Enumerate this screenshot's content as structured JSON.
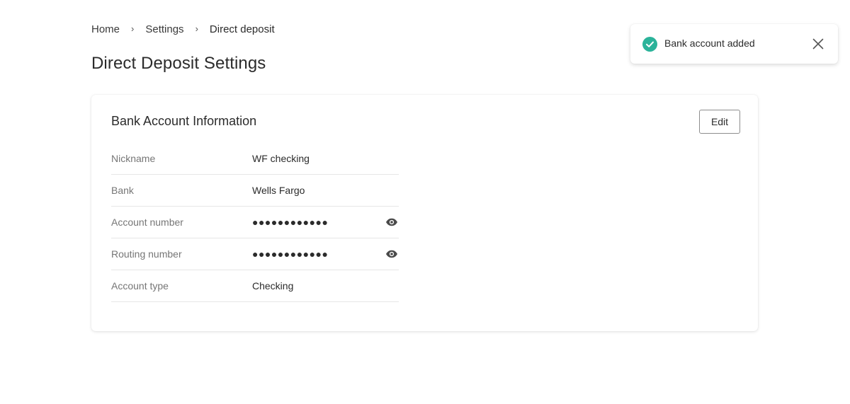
{
  "breadcrumb": {
    "items": [
      "Home",
      "Settings",
      "Direct deposit"
    ],
    "separator": "›"
  },
  "page": {
    "title": "Direct Deposit Settings"
  },
  "card": {
    "title": "Bank Account Information",
    "edit_label": "Edit",
    "rows": [
      {
        "label": "Nickname",
        "value": "WF checking"
      },
      {
        "label": "Bank",
        "value": "Wells Fargo"
      },
      {
        "label": "Account number",
        "value": "●●●●●●●●●●●●",
        "masked": true,
        "reveal_icon": "eye-icon"
      },
      {
        "label": "Routing number",
        "value": "●●●●●●●●●●●●",
        "masked": true,
        "reveal_icon": "eye-icon"
      },
      {
        "label": "Account type",
        "value": "Checking"
      }
    ]
  },
  "toast": {
    "message": "Bank account added",
    "icon": "check-circle-icon",
    "close_icon": "close-icon",
    "accent_color": "#2bb39a"
  }
}
